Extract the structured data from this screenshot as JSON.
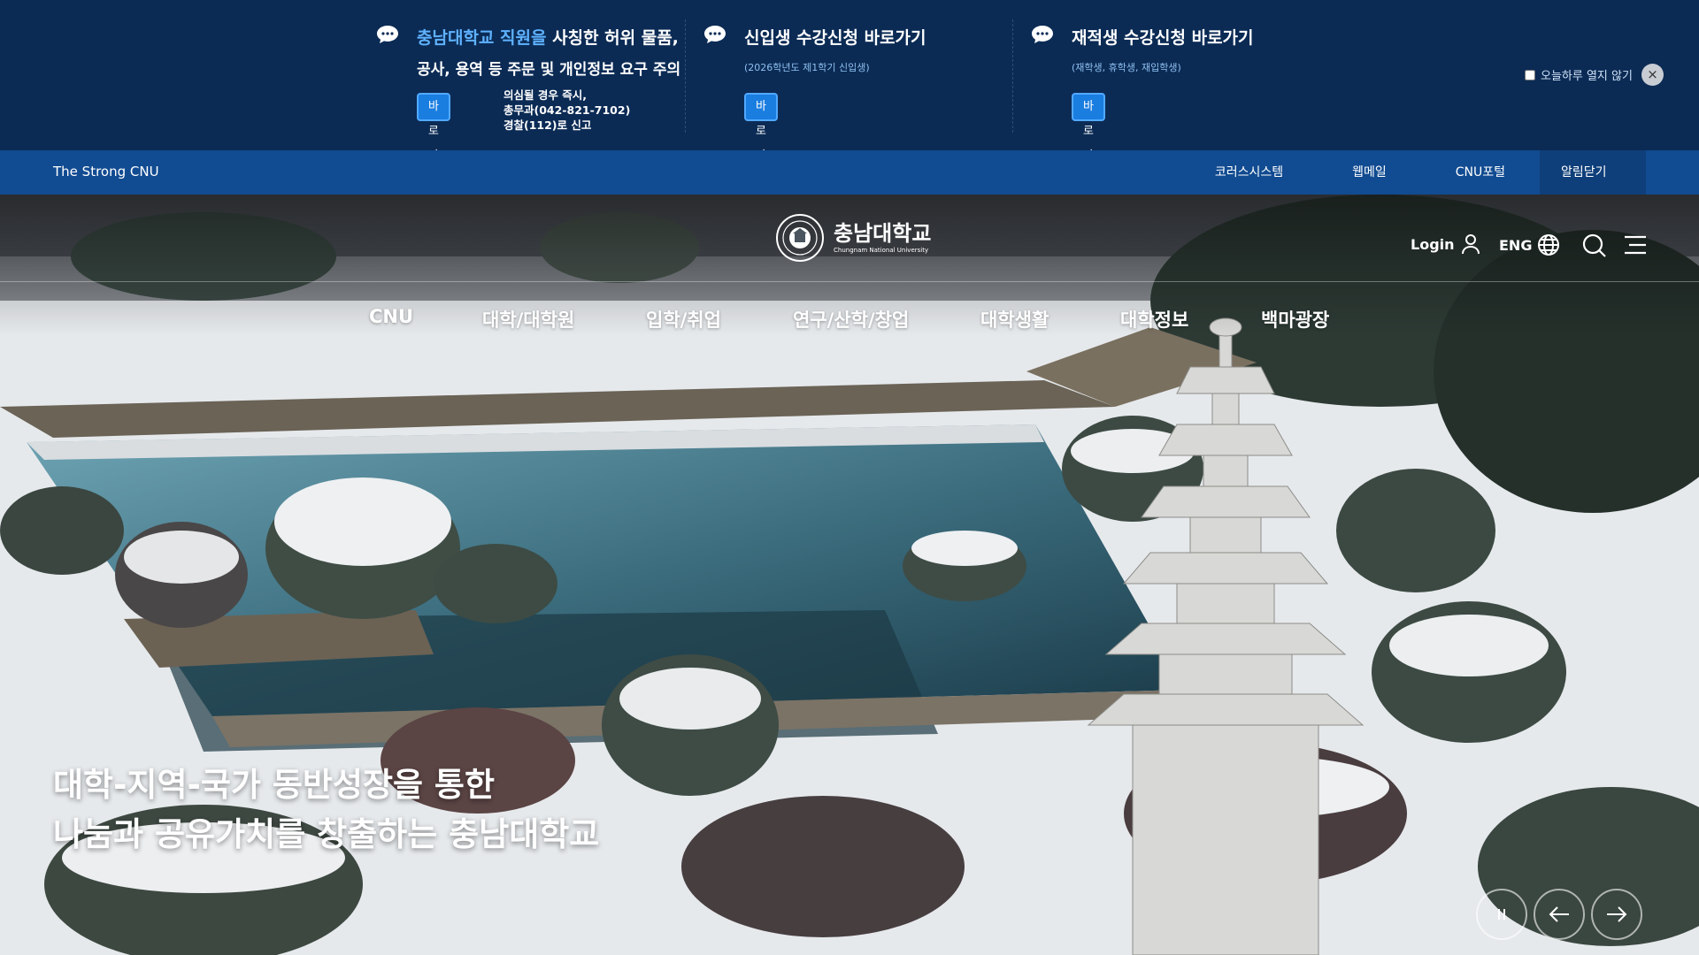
{
  "notices": [
    {
      "title_highlight": "충남대학교 직원을",
      "title_rest": "사칭한 허위 물품,",
      "title_line2": "공사, 용역 등 주문 및 개인정보 요구 주의",
      "button_label": "바로가기",
      "report_lines": [
        "의심될 경우 즉시,",
        "총무과(042-821-7102)",
        "경찰(112)로 신고"
      ]
    },
    {
      "title": "신입생 수강신청 바로가기",
      "subtitle": "(2026학년도 제1학기 신입생)",
      "button_label": "바로가기"
    },
    {
      "title": "재적생 수강신청 바로가기",
      "subtitle": "(재학생, 휴학생, 재입학생)",
      "button_label": "바로가기"
    }
  ],
  "hide_today_label": "오늘하루 열지 않기",
  "close_symbol": "×",
  "util_bar": {
    "slogan": "The Strong CNU",
    "links": [
      "코러스시스템",
      "웹메일",
      "CNU포털"
    ],
    "alert_close": "알림닫기"
  },
  "logo": {
    "name_ko": "충남대학교",
    "name_en": "Chungnam National University"
  },
  "header_actions": {
    "login": "Login",
    "lang": "ENG"
  },
  "gnb": [
    "CNU",
    "대학/대학원",
    "입학/취업",
    "연구/산학/창업",
    "대학생활",
    "대학정보",
    "백마광장"
  ],
  "headline": [
    "대학-지역-국가 동반성장을 통한",
    "나눔과 공유가치를 창출하는 충남대학교"
  ],
  "icons": [
    "chat-icon",
    "user-icon",
    "globe-icon",
    "search-icon",
    "menu-icon",
    "pause-icon",
    "arrow-left-icon",
    "arrow-right-icon"
  ],
  "colors": {
    "notice_bg": "#0b2b55",
    "util_bg": "#114b91",
    "button": "#1a7de0",
    "highlight": "#5fb2ff"
  }
}
